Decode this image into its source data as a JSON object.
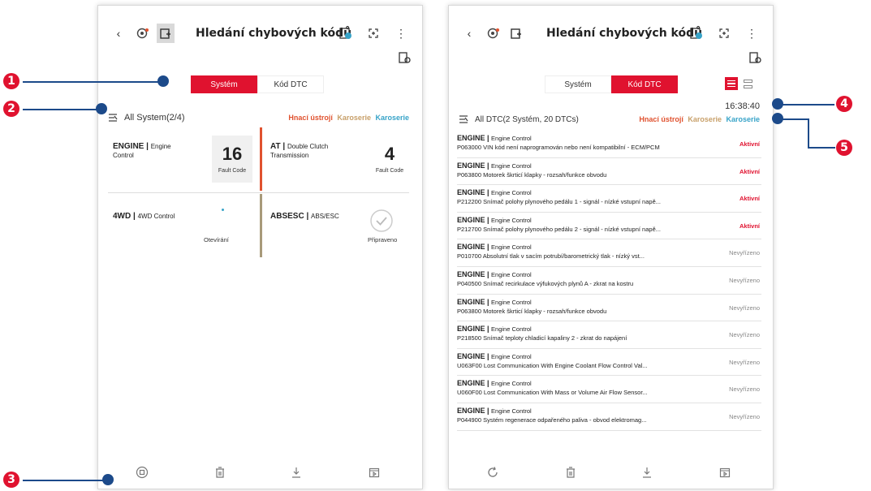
{
  "left": {
    "header": {
      "title": "Hledání chybových kódů"
    },
    "segment": {
      "system": "Systém",
      "dtc": "Kód DTC"
    },
    "summary": {
      "label": "All System(2/4)"
    },
    "legend": {
      "a": "Hnací ústrojí",
      "b": "Karoserie",
      "c": "Karoserie"
    },
    "tiles": [
      {
        "name": "ENGINE",
        "sub": "Engine Control",
        "num": "16",
        "unit": "Fault Code",
        "bar_color": "#e0522f"
      },
      {
        "name": "AT",
        "sub": "Double Clutch Transmission",
        "num": "4",
        "unit": "Fault Code",
        "bar_color": ""
      },
      {
        "name": "4WD",
        "sub": "4WD Control",
        "status": "Otevírání",
        "bar_color": "#a89a7a"
      },
      {
        "name": "ABSESC",
        "sub": "ABS/ESC",
        "status": "Připraveno",
        "bar_color": ""
      }
    ]
  },
  "right": {
    "header": {
      "title": "Hledání chybových kódů"
    },
    "segment": {
      "system": "Systém",
      "dtc": "Kód DTC"
    },
    "time": "16:38:40",
    "summary": {
      "label": "All DTC(2 Systém, 20 DTCs)"
    },
    "legend": {
      "a": "Hnací ústrojí",
      "b": "Karoserie",
      "c": "Karoserie"
    },
    "rows": [
      {
        "m": "ENGINE",
        "s": "Engine Control",
        "d": "P063000 VIN kód není naprogramován nebo není kompatibilní - ECM/PCM",
        "st": "Aktivní",
        "active": true
      },
      {
        "m": "ENGINE",
        "s": "Engine Control",
        "d": "P063800 Motorek škrticí klapky - rozsah/funkce obvodu",
        "st": "Aktivní",
        "active": true
      },
      {
        "m": "ENGINE",
        "s": "Engine Control",
        "d": "P212200 Snímač polohy plynového pedálu 1 - signál - nízké vstupní napě...",
        "st": "Aktivní",
        "active": true
      },
      {
        "m": "ENGINE",
        "s": "Engine Control",
        "d": "P212700 Snímač polohy plynového pedálu 2 - signál - nízké vstupní napě...",
        "st": "Aktivní",
        "active": true
      },
      {
        "m": "ENGINE",
        "s": "Engine Control",
        "d": "P010700 Absolutní tlak v sacím potrubí/barometrický tlak - nízký vst...",
        "st": "Nevyřízeno",
        "active": false
      },
      {
        "m": "ENGINE",
        "s": "Engine Control",
        "d": "P040500 Snímač recirkulace výfukových plynů A - zkrat na kostru",
        "st": "Nevyřízeno",
        "active": false
      },
      {
        "m": "ENGINE",
        "s": "Engine Control",
        "d": "P063800 Motorek škrticí klapky - rozsah/funkce obvodu",
        "st": "Nevyřízeno",
        "active": false
      },
      {
        "m": "ENGINE",
        "s": "Engine Control",
        "d": "P218500 Snímač teploty chladicí kapaliny 2 - zkrat do napájení",
        "st": "Nevyřízeno",
        "active": false
      },
      {
        "m": "ENGINE",
        "s": "Engine Control",
        "d": "U063F00 Lost Communication With Engine Coolant Flow Control Val...",
        "st": "Nevyřízeno",
        "active": false
      },
      {
        "m": "ENGINE",
        "s": "Engine Control",
        "d": "U060F00 Lost Communication With Mass or Volume Air Flow Sensor...",
        "st": "Nevyřízeno",
        "active": false
      },
      {
        "m": "ENGINE",
        "s": "Engine Control",
        "d": "P044900 Systém regenerace odpařeného paliva - obvod elektromag...",
        "st": "Nevyřízeno",
        "active": false
      }
    ]
  },
  "callouts": [
    "1",
    "2",
    "3",
    "4",
    "5"
  ],
  "colors": {
    "accent": "#e0122f",
    "callout_line": "#1c4a8a"
  }
}
